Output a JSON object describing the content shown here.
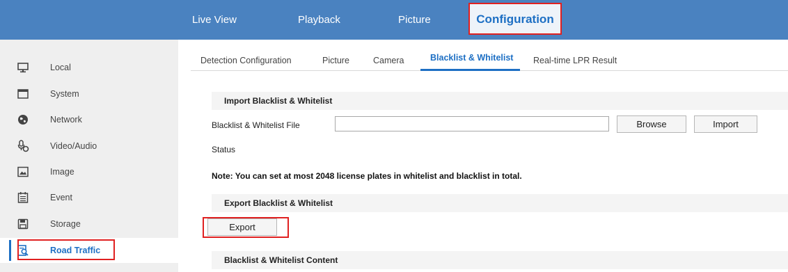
{
  "header": {
    "nav": [
      {
        "label": "Live View"
      },
      {
        "label": "Playback"
      },
      {
        "label": "Picture"
      },
      {
        "label": "Configuration",
        "active": true
      }
    ]
  },
  "sidebar": {
    "items": [
      {
        "label": "Local",
        "icon": "monitor-icon"
      },
      {
        "label": "System",
        "icon": "window-icon"
      },
      {
        "label": "Network",
        "icon": "globe-icon"
      },
      {
        "label": "Video/Audio",
        "icon": "microphone-icon"
      },
      {
        "label": "Image",
        "icon": "image-icon"
      },
      {
        "label": "Event",
        "icon": "calendar-icon"
      },
      {
        "label": "Storage",
        "icon": "floppy-disk-icon"
      },
      {
        "label": "Road Traffic",
        "icon": "road-traffic-icon",
        "active": true
      }
    ]
  },
  "tabs": [
    {
      "label": "Detection Configuration"
    },
    {
      "label": "Picture"
    },
    {
      "label": "Camera"
    },
    {
      "label": "Blacklist & Whitelist",
      "active": true
    },
    {
      "label": "Real-time LPR Result"
    }
  ],
  "import_section": {
    "title": "Import Blacklist & Whitelist",
    "file_label": "Blacklist & Whitelist File",
    "file_value": "",
    "browse_label": "Browse",
    "import_label": "Import",
    "status_label": "Status"
  },
  "note": "Note: You can set at most 2048 license plates in whitelist and blacklist in total.",
  "export_section": {
    "title": "Export Blacklist & Whitelist",
    "export_label": "Export"
  },
  "content_section": {
    "title": "Blacklist & Whitelist Content"
  },
  "colors": {
    "header_bg": "#4a82c0",
    "accent": "#1d6fc4",
    "highlight_border": "#e02020",
    "sidebar_bg": "#efefef"
  }
}
